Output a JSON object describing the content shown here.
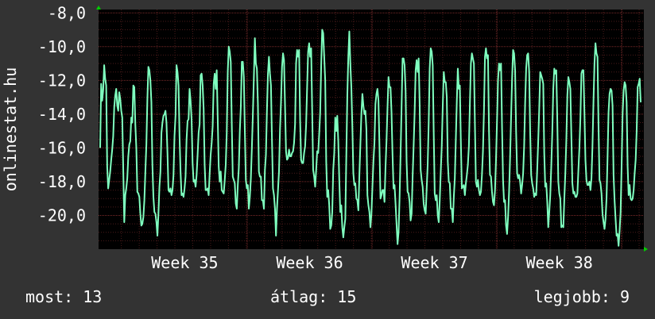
{
  "chart_data": {
    "type": "line",
    "side_label": "onlinestat.hu",
    "x_ticks": [
      "Week 35",
      "Week 36",
      "Week 37",
      "Week 38"
    ],
    "y_ticks": [
      "-8,0",
      "-10,0",
      "-12,0",
      "-14,0",
      "-16,0",
      "-18,0",
      "-20,0"
    ],
    "y_tick_values": [
      -8,
      -10,
      -12,
      -14,
      -16,
      -18,
      -20
    ],
    "ylim": [
      -22,
      -7.8
    ],
    "grid": true,
    "line_color": "#7fffbf",
    "series": [
      {
        "y": [
          -16.0,
          -12.2,
          -13.2,
          -12.6,
          -11.1,
          -11.9,
          -12.3,
          -17.1,
          -18.4,
          -17.9,
          -17.4,
          -16.7,
          -16.1,
          -15.3,
          -13.6,
          -12.9,
          -12.5,
          -13.5,
          -13.8,
          -12.7,
          -13.1,
          -13.8,
          -14.2,
          -17.3,
          -20.4,
          -18.8,
          -18.4,
          -17.8,
          -16.5,
          -15.8,
          -15.6,
          -14.2,
          -14.5,
          -12.3,
          -12.4,
          -14.6,
          -16.0,
          -18.6,
          -18.7,
          -18.9,
          -19.9,
          -20.6,
          -20.5,
          -20.1,
          -19.1,
          -17.4,
          -15.8,
          -13.1,
          -11.2,
          -11.4,
          -12.0,
          -13.3,
          -17.0,
          -18.9,
          -19.8,
          -19.9,
          -20.4,
          -21.2,
          -19.9,
          -18.3,
          -17.4,
          -15.1,
          -14.5,
          -14.1,
          -14.0,
          -13.8,
          -14.5,
          -16.3,
          -18.5,
          -18.6,
          -18.4,
          -18.8,
          -18.5,
          -17.6,
          -15.3,
          -14.1,
          -11.1,
          -11.5,
          -12.3,
          -15.3,
          -17.4,
          -18.8,
          -18.7,
          -18.9,
          -18.4,
          -17.7,
          -15.5,
          -14.4,
          -14.3,
          -12.5,
          -13.2,
          -14.3,
          -16.9,
          -18.0,
          -17.9,
          -18.3,
          -17.6,
          -16.4,
          -15.1,
          -14.6,
          -11.7,
          -11.6,
          -12.3,
          -13.7,
          -17.0,
          -18.5,
          -18.5,
          -18.4,
          -18.8,
          -17.5,
          -16.4,
          -15.7,
          -14.7,
          -12.2,
          -11.6,
          -12.5,
          -11.4,
          -14.2,
          -17.1,
          -18.0,
          -17.4,
          -18.5,
          -18.6,
          -18.7,
          -17.9,
          -17.0,
          -15.1,
          -11.5,
          -10.0,
          -10.3,
          -10.9,
          -14.6,
          -17.7,
          -17.9,
          -18.1,
          -19.3,
          -19.6,
          -18.2,
          -17.2,
          -15.0,
          -13.6,
          -10.9,
          -10.9,
          -11.8,
          -15.0,
          -17.9,
          -18.4,
          -18.2,
          -19.6,
          -18.9,
          -17.8,
          -16.0,
          -14.0,
          -11.8,
          -9.5,
          -11.0,
          -11.3,
          -13.4,
          -17.4,
          -17.7,
          -17.7,
          -19.1,
          -19.1,
          -19.6,
          -17.3,
          -16.4,
          -13.8,
          -11.6,
          -10.6,
          -11.6,
          -12.3,
          -15.5,
          -18.4,
          -18.8,
          -19.6,
          -21.2,
          -19.6,
          -18.5,
          -17.4,
          -14.9,
          -13.3,
          -11.2,
          -10.4,
          -10.8,
          -13.5,
          -16.2,
          -16.7,
          -16.6,
          -16.1,
          -16.5,
          -16.5,
          -16.3,
          -16.2,
          -15.7,
          -14.6,
          -11.0,
          -10.2,
          -10.6,
          -10.2,
          -14.3,
          -16.7,
          -16.9,
          -16.9,
          -16.3,
          -15.9,
          -14.6,
          -12.4,
          -10.3,
          -9.8,
          -10.6,
          -10.1,
          -13.7,
          -17.3,
          -17.7,
          -18.3,
          -17.3,
          -16.2,
          -16.3,
          -15.2,
          -13.9,
          -11.1,
          -9.0,
          -9.2,
          -10.6,
          -12.0,
          -16.8,
          -18.9,
          -18.5,
          -19.4,
          -20.8,
          -20.6,
          -19.8,
          -17.3,
          -16.3,
          -14.2,
          -15.0,
          -14.1,
          -15.6,
          -17.9,
          -19.8,
          -19.4,
          -20.7,
          -21.3,
          -20.7,
          -20.2,
          -16.5,
          -12.9,
          -10.6,
          -9.1,
          -11.0,
          -12.4,
          -14.7,
          -17.5,
          -18.2,
          -18.1,
          -19.0,
          -19.1,
          -19.7,
          -17.6,
          -15.8,
          -14.0,
          -12.8,
          -13.5,
          -14.0,
          -13.8,
          -14.9,
          -18.8,
          -19.4,
          -19.8,
          -20.7,
          -19.9,
          -18.3,
          -16.8,
          -15.7,
          -13.4,
          -12.8,
          -12.5,
          -13.2,
          -15.9,
          -19.0,
          -18.8,
          -18.5,
          -18.5,
          -19.2,
          -17.2,
          -15.6,
          -13.6,
          -11.8,
          -12.4,
          -12.4,
          -13.9,
          -16.4,
          -18.4,
          -18.2,
          -19.3,
          -20.5,
          -21.7,
          -21.0,
          -19.0,
          -16.4,
          -13.6,
          -10.7,
          -10.7,
          -11.1,
          -12.6,
          -16.8,
          -18.6,
          -18.7,
          -19.2,
          -20.3,
          -19.9,
          -17.7,
          -15.9,
          -13.9,
          -11.4,
          -10.8,
          -11.5,
          -10.7,
          -13.4,
          -17.3,
          -17.9,
          -18.3,
          -19.3,
          -19.7,
          -19.9,
          -18.4,
          -17.0,
          -14.5,
          -11.3,
          -10.1,
          -10.3,
          -11.1,
          -15.1,
          -18.7,
          -19.1,
          -18.8,
          -20.0,
          -20.4,
          -19.1,
          -17.4,
          -15.9,
          -13.5,
          -11.5,
          -12.1,
          -12.1,
          -13.0,
          -16.8,
          -18.0,
          -18.1,
          -19.6,
          -19.6,
          -20.4,
          -18.9,
          -17.8,
          -15.5,
          -13.2,
          -11.3,
          -12.5,
          -12.3,
          -15.6,
          -18.4,
          -18.3,
          -18.2,
          -18.8,
          -18.1,
          -17.6,
          -17.0,
          -15.9,
          -13.4,
          -11.0,
          -10.4,
          -10.7,
          -11.0,
          -14.6,
          -18.0,
          -18.3,
          -17.9,
          -18.5,
          -18.8,
          -18.6,
          -17.6,
          -16.2,
          -13.8,
          -10.6,
          -10.1,
          -10.7,
          -10.5,
          -14.9,
          -17.6,
          -17.7,
          -18.6,
          -19.2,
          -19.4,
          -18.5,
          -16.7,
          -14.4,
          -12.0,
          -11.0,
          -11.4,
          -11.0,
          -14.8,
          -17.9,
          -19.2,
          -19.1,
          -20.6,
          -21.1,
          -20.1,
          -18.6,
          -16.6,
          -14.2,
          -11.9,
          -10.2,
          -10.4,
          -11.4,
          -15.0,
          -17.5,
          -17.8,
          -17.6,
          -18.0,
          -18.7,
          -18.2,
          -17.5,
          -15.9,
          -13.3,
          -11.3,
          -10.5,
          -10.4,
          -11.5,
          -15.1,
          -17.6,
          -18.1,
          -18.4,
          -18.9,
          -18.7,
          -18.8,
          -17.3,
          -15.6,
          -13.7,
          -11.5,
          -11.7,
          -11.9,
          -12.2,
          -16.3,
          -18.3,
          -18.1,
          -19.2,
          -20.7,
          -19.8,
          -18.8,
          -17.1,
          -15.1,
          -12.5,
          -11.3,
          -11.6,
          -11.4,
          -14.4,
          -18.0,
          -18.7,
          -19.0,
          -20.7,
          -20.6,
          -20.7,
          -19.0,
          -17.5,
          -15.5,
          -12.9,
          -11.8,
          -12.1,
          -12.5,
          -15.3,
          -18.1,
          -18.7,
          -18.6,
          -18.9,
          -18.9,
          -18.7,
          -17.3,
          -16.0,
          -14.2,
          -11.6,
          -11.4,
          -11.4,
          -13.9,
          -16.7,
          -17.9,
          -18.2,
          -18.2,
          -18.0,
          -18.5,
          -17.8,
          -15.9,
          -13.3,
          -11.0,
          -9.8,
          -10.4,
          -10.6,
          -14.6,
          -17.9,
          -18.1,
          -18.7,
          -19.9,
          -20.4,
          -20.8,
          -20.2,
          -19.0,
          -16.6,
          -13.9,
          -12.8,
          -12.5,
          -12.6,
          -13.5,
          -17.6,
          -19.1,
          -20.2,
          -21.2,
          -21.1,
          -21.8,
          -20.9,
          -19.8,
          -17.1,
          -14.0,
          -12.6,
          -12.1,
          -12.3,
          -13.3,
          -17.1,
          -18.8,
          -18.2,
          -19.0,
          -19.1,
          -19.0,
          -18.5,
          -17.5,
          -16.7,
          -15.0,
          -12.4,
          -12.2,
          -11.9,
          -13.3
        ]
      }
    ],
    "footer": {
      "current": "most: 13",
      "average": "átlag: 15",
      "best": "legjobb: 9"
    }
  }
}
